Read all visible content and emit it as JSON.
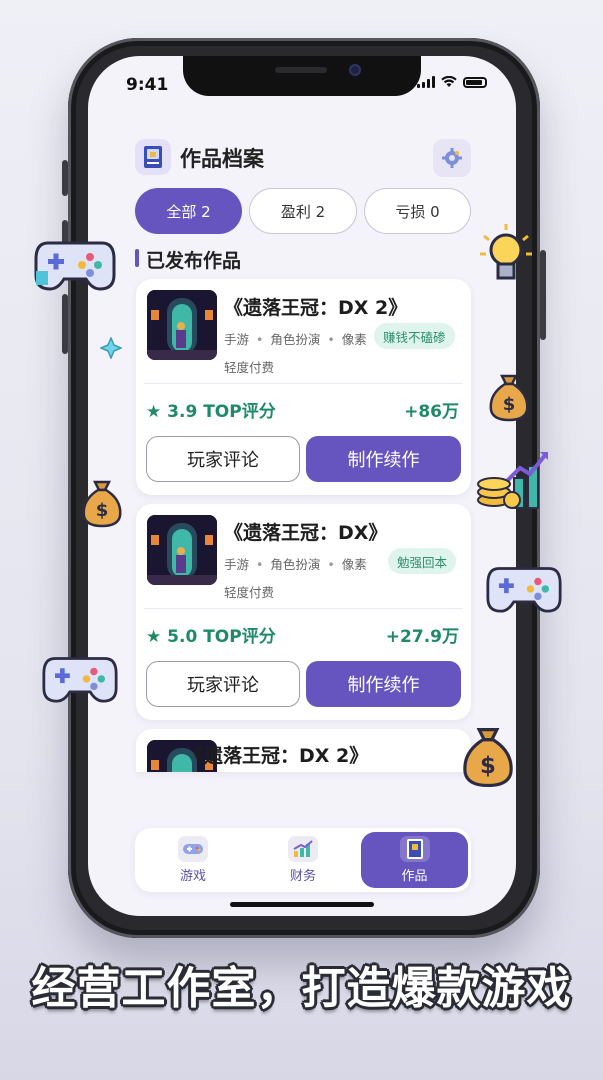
{
  "status_bar": {
    "time": "9:41"
  },
  "header": {
    "title": "作品档案"
  },
  "filters": [
    {
      "label": "全部 2",
      "active": true
    },
    {
      "label": "盈利 2",
      "active": false
    },
    {
      "label": "亏损 0",
      "active": false
    }
  ],
  "section": {
    "title": "已发布作品"
  },
  "games": [
    {
      "title": "《遗落王冠：DX 2》",
      "platform": "手游",
      "genre": "角色扮演",
      "style": "像素",
      "badge": "赚钱不磕碜",
      "payment": "轻度付费",
      "rating": "★ 3.9 TOP评分",
      "income": "+86万",
      "comment_label": "玩家评论",
      "sequel_label": "制作续作"
    },
    {
      "title": "《遗落王冠：DX》",
      "platform": "手游",
      "genre": "角色扮演",
      "style": "像素",
      "badge": "勉强回本",
      "payment": "轻度付费",
      "rating": "★ 5.0 TOP评分",
      "income": "+27.9万",
      "comment_label": "玩家评论",
      "sequel_label": "制作续作"
    },
    {
      "title": "《遗落王冠：DX 2》"
    }
  ],
  "bottom_nav": [
    {
      "label": "游戏",
      "icon": "gamepad-icon",
      "active": false
    },
    {
      "label": "财务",
      "icon": "finance-chart-icon",
      "active": false
    },
    {
      "label": "作品",
      "icon": "portfolio-book-icon",
      "active": true
    }
  ],
  "slogan": "经营工作室，打造爆款游戏",
  "colors": {
    "accent": "#6655bf",
    "positive": "#1f8a68",
    "badge_bg": "#dff4ec"
  }
}
